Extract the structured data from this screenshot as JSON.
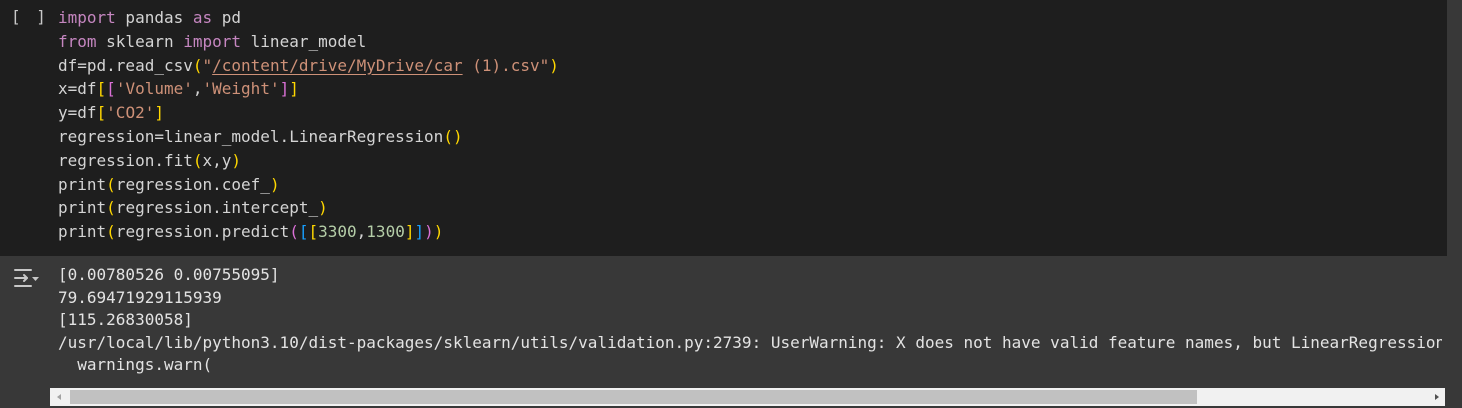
{
  "cell": {
    "run_indicator": "[ ]",
    "code_lines": [
      [
        {
          "t": "import",
          "c": "kw"
        },
        {
          "t": " pandas "
        },
        {
          "t": "as",
          "c": "kw"
        },
        {
          "t": " pd"
        }
      ],
      [
        {
          "t": "from",
          "c": "kw"
        },
        {
          "t": " sklearn "
        },
        {
          "t": "import",
          "c": "kw"
        },
        {
          "t": " linear_model"
        }
      ],
      [
        {
          "t": "df=pd.read_csv"
        },
        {
          "t": "(",
          "c": "p1"
        },
        {
          "t": "\"",
          "c": "str"
        },
        {
          "t": "/content/drive/MyDrive/car",
          "c": "str link"
        },
        {
          "t": " (1).csv\"",
          "c": "str"
        },
        {
          "t": ")",
          "c": "p1"
        }
      ],
      [
        {
          "t": "x=df"
        },
        {
          "t": "[",
          "c": "p1"
        },
        {
          "t": "[",
          "c": "p2"
        },
        {
          "t": "'Volume'",
          "c": "str"
        },
        {
          "t": ","
        },
        {
          "t": "'Weight'",
          "c": "str"
        },
        {
          "t": "]",
          "c": "p2"
        },
        {
          "t": "]",
          "c": "p1"
        }
      ],
      [
        {
          "t": "y=df"
        },
        {
          "t": "[",
          "c": "p1"
        },
        {
          "t": "'CO2'",
          "c": "str"
        },
        {
          "t": "]",
          "c": "p1"
        }
      ],
      [
        {
          "t": "regression=linear_model.LinearRegression"
        },
        {
          "t": "()",
          "c": "p1"
        }
      ],
      [
        {
          "t": "regression.fit"
        },
        {
          "t": "(",
          "c": "p1"
        },
        {
          "t": "x,y"
        },
        {
          "t": ")",
          "c": "p1"
        }
      ],
      [
        {
          "t": "print"
        },
        {
          "t": "(",
          "c": "p1"
        },
        {
          "t": "regression.coef_"
        },
        {
          "t": ")",
          "c": "p1"
        }
      ],
      [
        {
          "t": "print"
        },
        {
          "t": "(",
          "c": "p1"
        },
        {
          "t": "regression.intercept_"
        },
        {
          "t": ")",
          "c": "p1"
        }
      ],
      [
        {
          "t": "print"
        },
        {
          "t": "(",
          "c": "p1"
        },
        {
          "t": "regression.predict"
        },
        {
          "t": "(",
          "c": "p2"
        },
        {
          "t": "[",
          "c": "p3"
        },
        {
          "t": "[",
          "c": "p1"
        },
        {
          "t": "3300",
          "c": "num"
        },
        {
          "t": ","
        },
        {
          "t": "1300",
          "c": "num"
        },
        {
          "t": "]",
          "c": "p1"
        },
        {
          "t": "]",
          "c": "p3"
        },
        {
          "t": ")",
          "c": "p2"
        },
        {
          "t": ")",
          "c": "p1"
        }
      ]
    ],
    "output_icon": "output-settings-icon",
    "output_lines": [
      "[0.00780526 0.00755095]",
      "79.69471929115939",
      "[115.26830058]",
      "/usr/local/lib/python3.10/dist-packages/sklearn/utils/validation.py:2739: UserWarning: X does not have valid feature names, but LinearRegression",
      "  warnings.warn("
    ]
  },
  "colors": {
    "code_bg": "#1e1e1e",
    "output_bg": "#383838",
    "keyword": "#c586c0",
    "string": "#ce9178",
    "number": "#b5cea8"
  }
}
